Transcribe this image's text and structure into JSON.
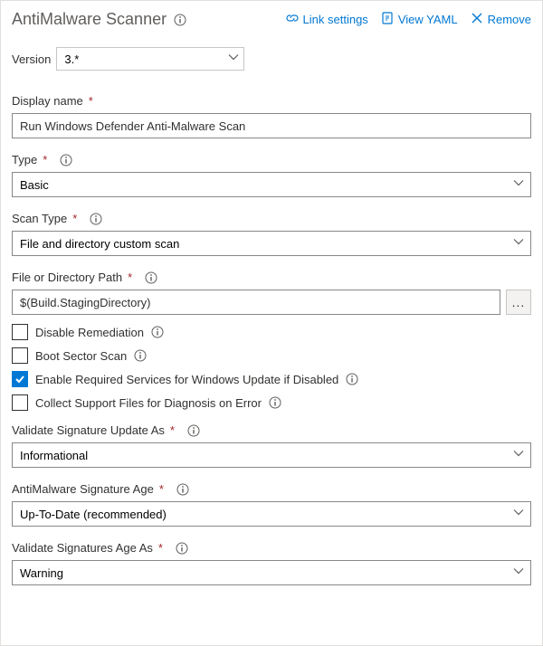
{
  "header": {
    "title": "AntiMalware Scanner",
    "actions": {
      "link_settings": "Link settings",
      "view_yaml": "View YAML",
      "remove": "Remove"
    }
  },
  "version": {
    "label": "Version",
    "value": "3.*"
  },
  "fields": {
    "display_name": {
      "label": "Display name",
      "value": "Run Windows Defender Anti-Malware Scan"
    },
    "type": {
      "label": "Type",
      "value": "Basic"
    },
    "scan_type": {
      "label": "Scan Type",
      "value": "File and directory custom scan"
    },
    "path": {
      "label": "File or Directory Path",
      "value": "$(Build.StagingDirectory)"
    },
    "validate_sig_update": {
      "label": "Validate Signature Update As",
      "value": "Informational"
    },
    "sig_age": {
      "label": "AntiMalware Signature Age",
      "value": "Up-To-Date (recommended)"
    },
    "validate_sig_age": {
      "label": "Validate Signatures Age As",
      "value": "Warning"
    }
  },
  "checks": {
    "disable_remediation": {
      "label": "Disable Remediation",
      "checked": false
    },
    "boot_sector": {
      "label": "Boot Sector Scan",
      "checked": false
    },
    "enable_services": {
      "label": "Enable Required Services for Windows Update if Disabled",
      "checked": true
    },
    "collect_support": {
      "label": "Collect Support Files for Diagnosis on Error",
      "checked": false
    }
  },
  "ellipsis": "..."
}
